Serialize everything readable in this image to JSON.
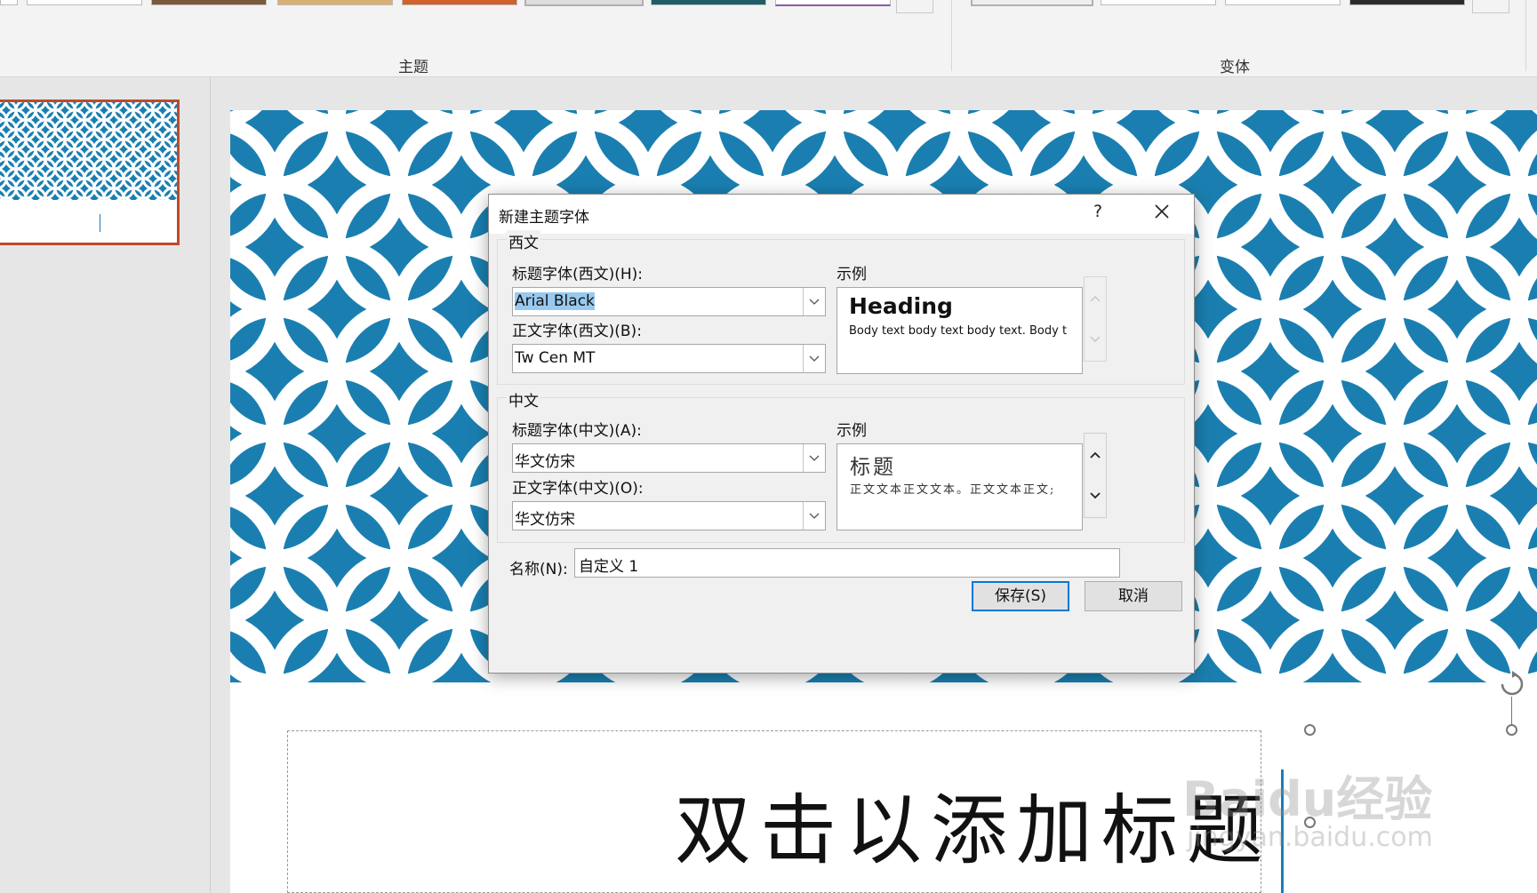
{
  "ribbon": {
    "themes_label": "主题",
    "variants_label": "变体"
  },
  "slide": {
    "title_placeholder": "双击以添加标题"
  },
  "watermark": {
    "logo": "Baidu经验",
    "url": "jingyan.baidu.com"
  },
  "colors": {
    "pattern_blue": "#1a7fb0",
    "thumb_border": "#c0492a",
    "selection": "#99c9ef",
    "default_button_border": "#0078d7"
  },
  "dialog": {
    "title": "新建主题字体",
    "help": "?",
    "western": {
      "group_label": "西文",
      "heading_label": "标题字体(西文)(H):",
      "heading_value": "Arial Black",
      "body_label": "正文字体(西文)(B):",
      "body_value": "Tw Cen MT",
      "sample_label": "示例",
      "sample_heading": "Heading",
      "sample_body": "Body text body text body text. Body t"
    },
    "chinese": {
      "group_label": "中文",
      "heading_label": "标题字体(中文)(A):",
      "heading_value": "华文仿宋",
      "body_label": "正文字体(中文)(O):",
      "body_value": "华文仿宋",
      "sample_label": "示例",
      "sample_heading": "标题",
      "sample_body": "正文文本正文文本。正文文本正文;"
    },
    "name_label": "名称(N):",
    "name_value": "自定义 1",
    "save_label": "保存(S)",
    "cancel_label": "取消"
  }
}
